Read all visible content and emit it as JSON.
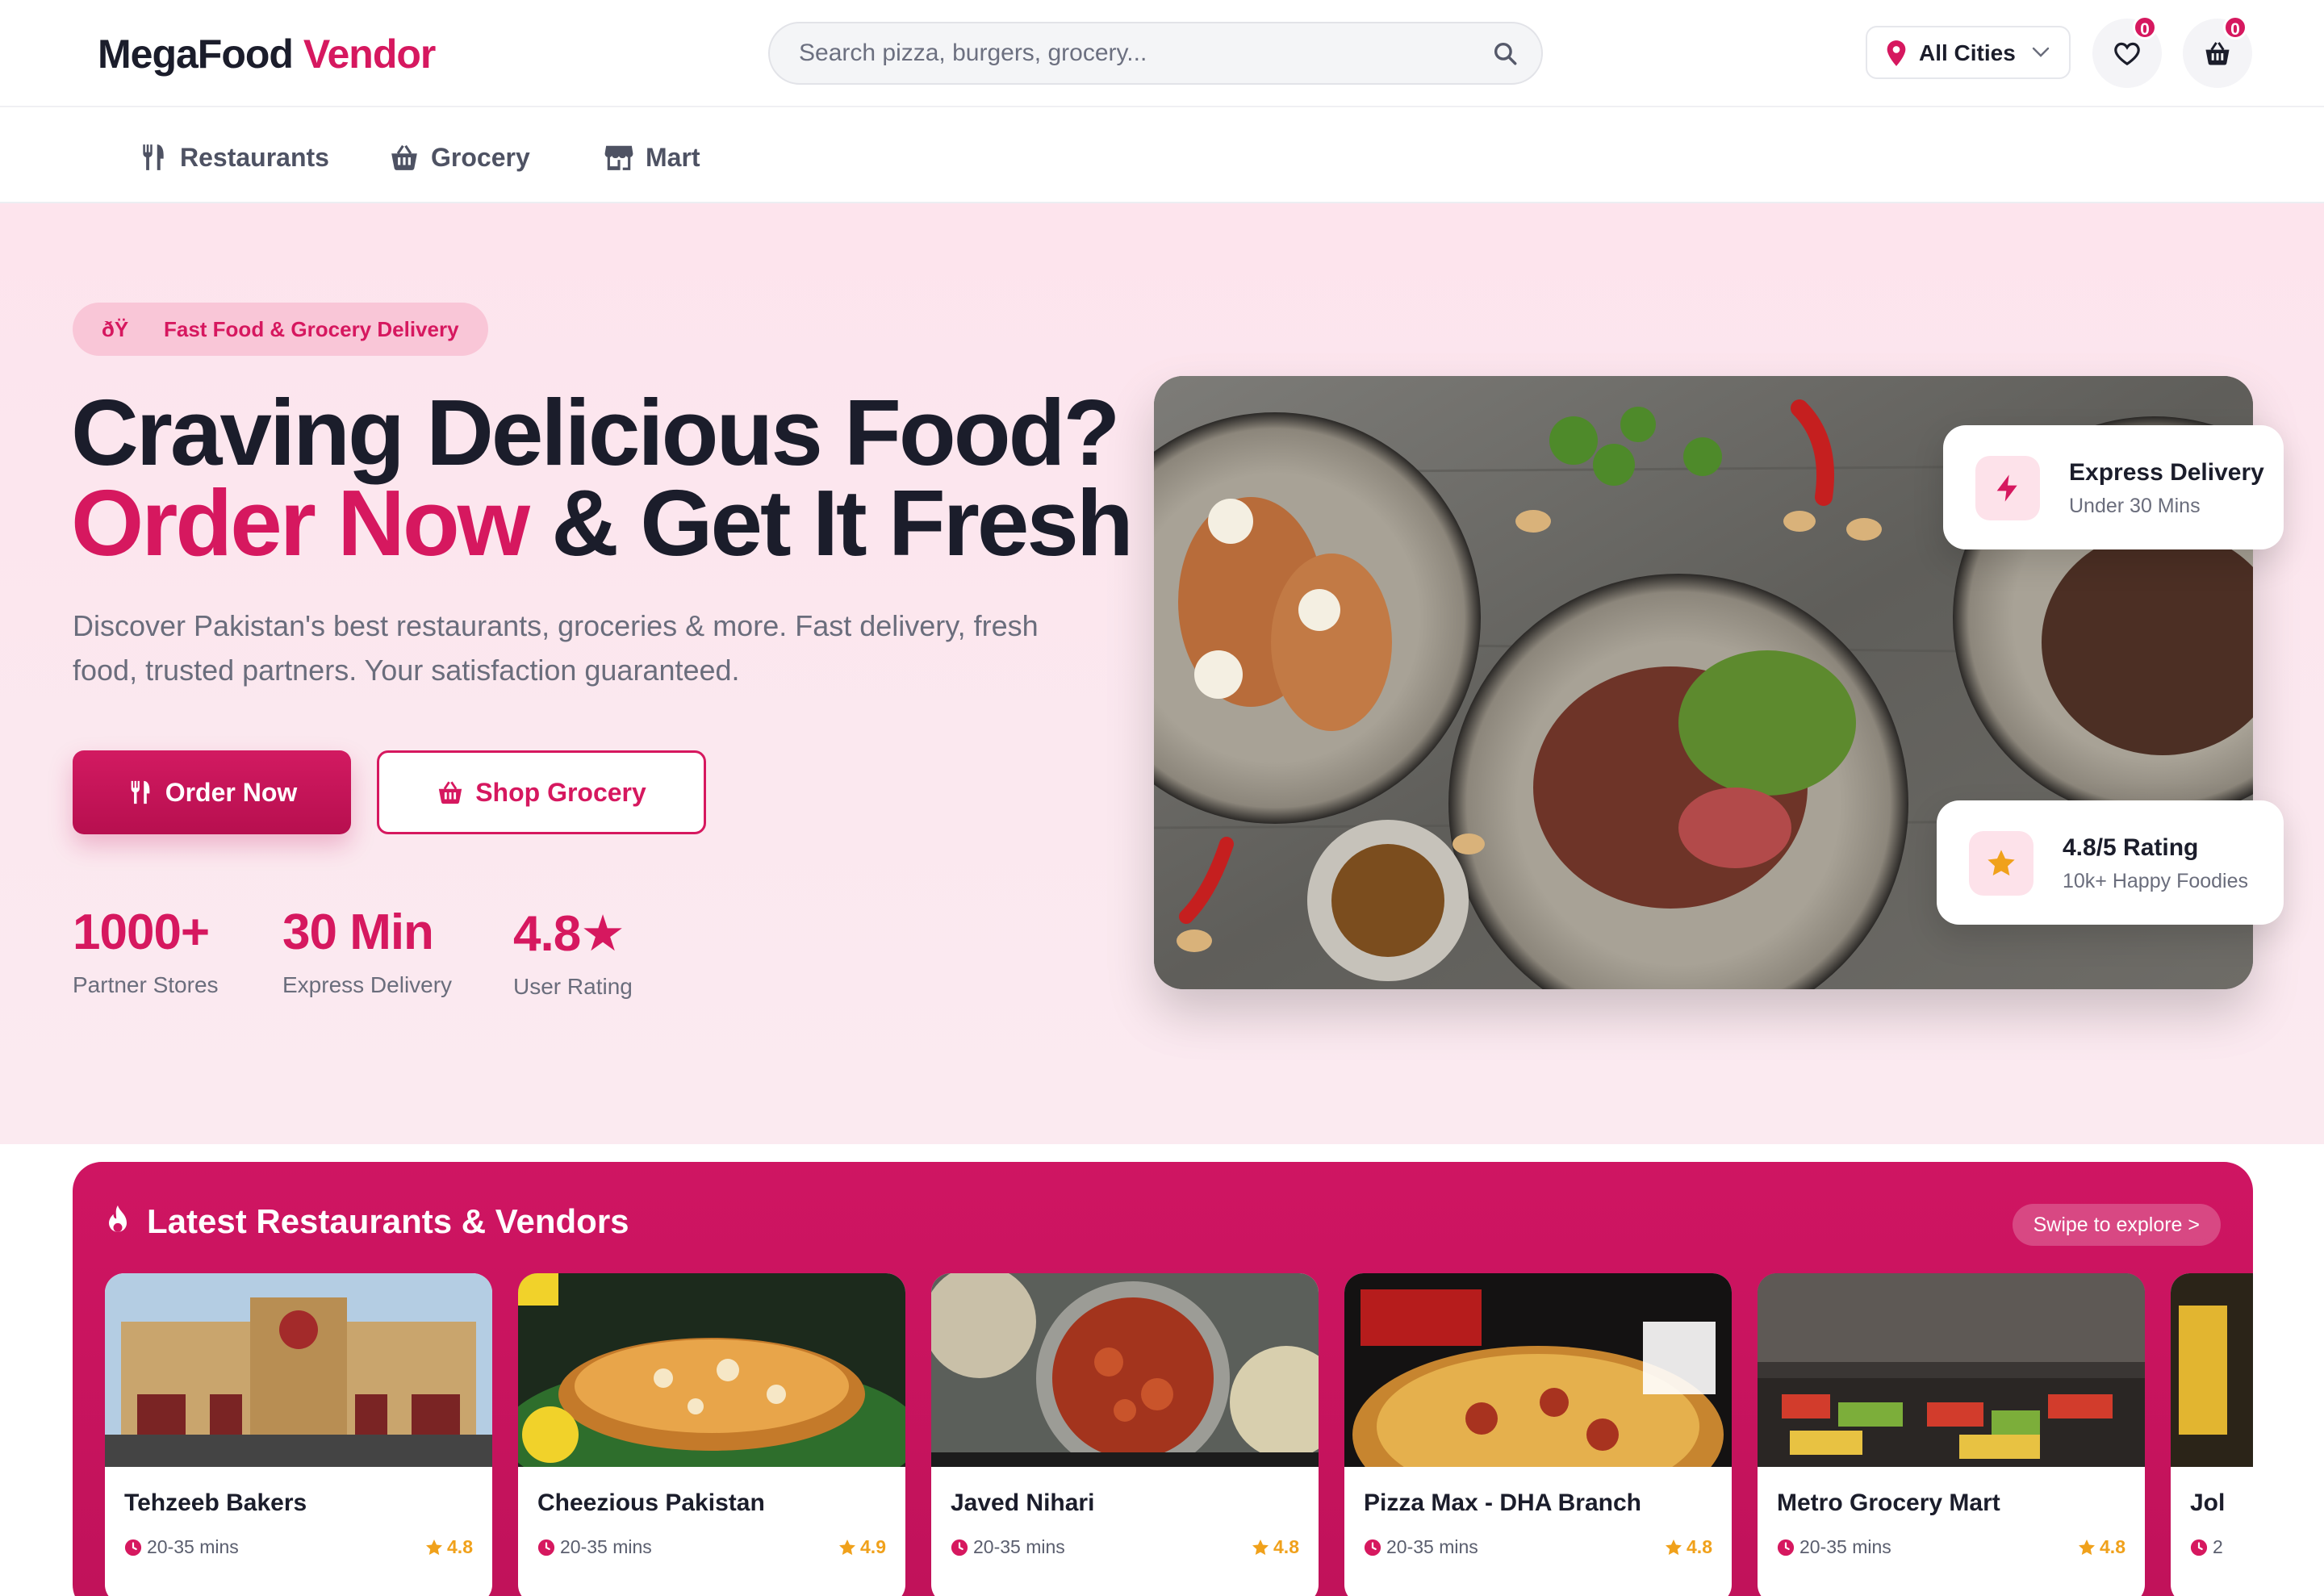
{
  "brand": {
    "name_main": "MegaFood",
    "name_accent": "Vendor",
    "accent_color": "#d6185f"
  },
  "search": {
    "placeholder": "Search pizza, burgers, grocery..."
  },
  "city_selector": {
    "label": "All Cities"
  },
  "wishlist": {
    "count": "0"
  },
  "cart": {
    "count": "0"
  },
  "categories": [
    {
      "label": "Restaurants",
      "icon": "utensils-icon"
    },
    {
      "label": "Grocery",
      "icon": "basket-icon"
    },
    {
      "label": "Mart",
      "icon": "store-icon"
    }
  ],
  "hero": {
    "pill": "ðŸ Fast Food & Grocery Delivery",
    "title_line1": "Craving Delicious Food?",
    "title_line2_accent": "Order Now",
    "title_line2_rest": " & Get It Fresh",
    "subtitle": "Discover Pakistan's best restaurants, groceries & more. Fast delivery, fresh food, trusted partners. Your satisfaction guaranteed.",
    "primary_button": "Order Now",
    "secondary_button": "Shop Grocery",
    "stats": [
      {
        "value": "1000+",
        "label": "Partner Stores"
      },
      {
        "value": "30 Min",
        "label": "Express Delivery"
      },
      {
        "value": "4.8★",
        "label": "User Rating"
      }
    ],
    "float_cards": [
      {
        "title": "Express Delivery",
        "subtitle": "Under 30 Mins",
        "icon": "lightning-icon"
      },
      {
        "title": "4.8/5 Rating",
        "subtitle": "10k+ Happy Foodies",
        "icon": "star-icon"
      }
    ]
  },
  "latest": {
    "title": "Latest Restaurants & Vendors",
    "swipe_hint": "Swipe to explore >",
    "vendors": [
      {
        "name": "Tehzeeb Bakers",
        "time": "20-35 mins",
        "rating": "4.8"
      },
      {
        "name": "Cheezious Pakistan",
        "time": "20-35 mins",
        "rating": "4.9"
      },
      {
        "name": "Javed Nihari",
        "time": "20-35 mins",
        "rating": "4.8"
      },
      {
        "name": "Pizza Max - DHA Branch",
        "time": "20-35 mins",
        "rating": "4.8"
      },
      {
        "name": "Metro Grocery Mart",
        "time": "20-35 mins",
        "rating": "4.8"
      },
      {
        "name": "Jol",
        "time": "2",
        "rating": ""
      }
    ]
  }
}
